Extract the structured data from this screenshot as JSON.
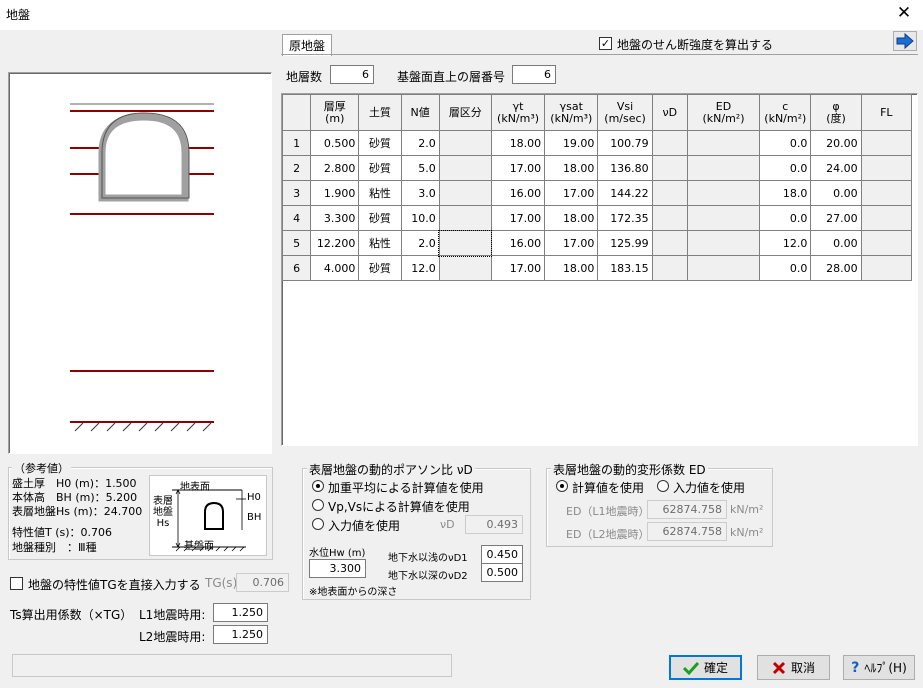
{
  "window": {
    "title": "地盤",
    "close": "✕"
  },
  "tab": {
    "label": "原地盤"
  },
  "shear_checkbox": {
    "checked": "✓",
    "label": "地盤のせん断強度を算出する"
  },
  "layers": {
    "count_label": "地層数",
    "count": "6",
    "base_label": "基盤面直上の層番号",
    "base": "6"
  },
  "table": {
    "headers": [
      [
        "",
        ""
      ],
      [
        "層厚",
        "(m)"
      ],
      [
        "土質",
        ""
      ],
      [
        "N値",
        ""
      ],
      [
        "層区分",
        ""
      ],
      [
        "γt",
        "(kN/m³)"
      ],
      [
        "γsat",
        "(kN/m³)"
      ],
      [
        "Vsi",
        "(m/sec)"
      ],
      [
        "νD",
        ""
      ],
      [
        "ED",
        "(kN/m²)"
      ],
      [
        "c",
        "(kN/m²)"
      ],
      [
        "φ",
        "(度)"
      ],
      [
        "FL",
        ""
      ]
    ],
    "rows": [
      [
        "1",
        "0.500",
        "砂質",
        "2.0",
        "",
        "18.00",
        "19.00",
        "100.79",
        "",
        "",
        "0.0",
        "20.00",
        ""
      ],
      [
        "2",
        "2.800",
        "砂質",
        "5.0",
        "",
        "17.00",
        "18.00",
        "136.80",
        "",
        "",
        "0.0",
        "24.00",
        ""
      ],
      [
        "3",
        "1.900",
        "粘性",
        "3.0",
        "",
        "16.00",
        "17.00",
        "144.22",
        "",
        "",
        "18.0",
        "0.00",
        ""
      ],
      [
        "4",
        "3.300",
        "砂質",
        "10.0",
        "",
        "17.00",
        "18.00",
        "172.35",
        "",
        "",
        "0.0",
        "27.00",
        ""
      ],
      [
        "5",
        "12.200",
        "粘性",
        "2.0",
        "",
        "16.00",
        "17.00",
        "125.99",
        "",
        "",
        "12.0",
        "0.00",
        ""
      ],
      [
        "6",
        "4.000",
        "砂質",
        "12.0",
        "",
        "17.00",
        "18.00",
        "183.15",
        "",
        "",
        "0.0",
        "28.00",
        ""
      ]
    ]
  },
  "reference": {
    "title": "（参考値）",
    "lines": [
      "盛土厚　H0 (m)：1.500",
      "本体高　BH (m)：5.200",
      "表層地盤Hs (m)：24.700"
    ],
    "tg_line": "特性値T (s)：0.706",
    "type_line": "地盤種別　：Ⅲ種",
    "diagram": {
      "surface": "地表面",
      "layer_label": "表層\n地盤\nHs",
      "base": "基盤面",
      "h0": "H0",
      "bh": "BH"
    }
  },
  "direct_tg": {
    "label": "地盤の特性値TGを直接入力する",
    "tg_label": "TG(s)",
    "tg_value": "0.706"
  },
  "ts_coef": {
    "label": "Ts算出用係数（×TG）",
    "l1_label": "L1地震時用:",
    "l1_value": "1.250",
    "l2_label": "L2地震時用:",
    "l2_value": "1.250"
  },
  "poisson": {
    "title": "表層地盤の動的ポアソン比 νD",
    "options": [
      "加重平均による計算値を使用",
      "Vp,Vsによる計算値を使用",
      "入力値を使用"
    ],
    "selected": 0,
    "nu_label": "νD",
    "nu_value": "0.493",
    "water_label": "水位Hw (m)",
    "water_value": "3.300",
    "shallow_label": "地下水以浅のνD1",
    "shallow_value": "0.450",
    "deep_label": "地下水以深のνD2",
    "deep_value": "0.500",
    "note": "※地表面からの深さ"
  },
  "ed": {
    "title": "表層地盤の動的変形係数 ED",
    "options": [
      "計算値を使用",
      "入力値を使用"
    ],
    "selected": 0,
    "l1_label": "ED（L1地震時）",
    "l1_value": "62874.758",
    "l2_label": "ED（L2地震時）",
    "l2_value": "62874.758",
    "unit": "kN/m²"
  },
  "buttons": {
    "ok": "確定",
    "cancel": "取消",
    "help": "ﾍﾙﾌﾟ(H)"
  },
  "colors": {
    "layer_line": "#8b0000",
    "ok_check": "#1aa01a",
    "cancel_x": "#c00000",
    "help_q": "#1560bd",
    "arrow": "#1a6fd0"
  }
}
